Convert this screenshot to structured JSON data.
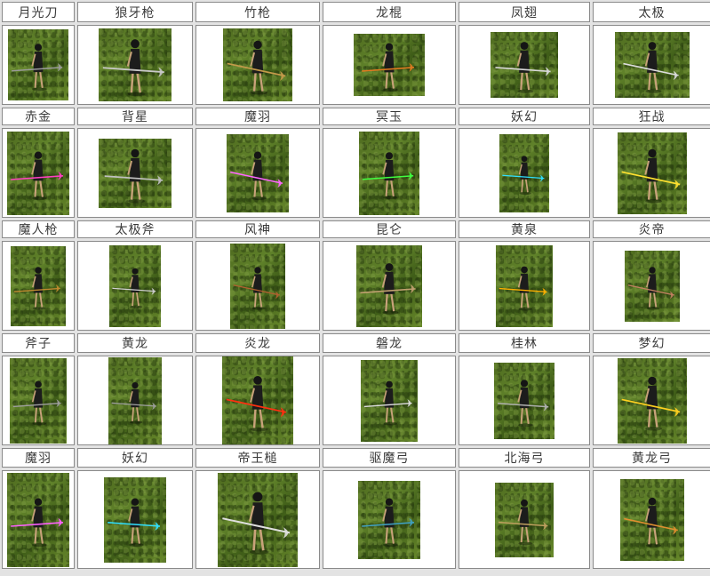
{
  "rows": [
    {
      "labels": [
        "月光刀",
        "狼牙枪",
        "竹枪",
        "龙棍",
        "凤翅",
        "太极"
      ],
      "colors": [
        "#9a9a9a",
        "#c8c8c8",
        "#c49a4a",
        "#e07a20",
        "#d8d8d8",
        "#dddddd"
      ]
    },
    {
      "labels": [
        "赤金",
        "背星",
        "魔羽",
        "冥玉",
        "妖幻",
        "狂战"
      ],
      "colors": [
        "#ff40c0",
        "#c0c0c0",
        "#ff66ff",
        "#40ff40",
        "#30e0ff",
        "#ffe030"
      ]
    },
    {
      "labels": [
        "魔人枪",
        "太极斧",
        "风神",
        "昆仑",
        "黄泉",
        "炎帝"
      ],
      "colors": [
        "#c08a30",
        "#d0d0d0",
        "#b06030",
        "#c0a070",
        "#ffb000",
        "#c08060"
      ]
    },
    {
      "labels": [
        "斧子",
        "黄龙",
        "炎龙",
        "磐龙",
        "桂林",
        "梦幻"
      ],
      "colors": [
        "#a0a0a0",
        "#a0a0a0",
        "#ff3010",
        "#e0e0e0",
        "#b0b0b0",
        "#ffd020"
      ]
    },
    {
      "labels": [
        "魔羽",
        "妖幻",
        "帝王槌",
        "驱魔弓",
        "北海弓",
        "黄龙弓"
      ],
      "colors": [
        "#ff60ff",
        "#30e0ff",
        "#e0e0e0",
        "#40a0c0",
        "#c0a060",
        "#e09030"
      ]
    }
  ],
  "thumb_sizes": [
    [
      [
        68,
        80
      ],
      [
        82,
        82
      ],
      [
        78,
        82
      ],
      [
        80,
        70
      ],
      [
        76,
        74
      ],
      [
        84,
        74
      ]
    ],
    [
      [
        70,
        94
      ],
      [
        82,
        78
      ],
      [
        70,
        88
      ],
      [
        68,
        94
      ],
      [
        56,
        88
      ],
      [
        78,
        92
      ]
    ],
    [
      [
        62,
        90
      ],
      [
        58,
        92
      ],
      [
        62,
        96
      ],
      [
        74,
        92
      ],
      [
        64,
        92
      ],
      [
        62,
        80
      ]
    ],
    [
      [
        64,
        96
      ],
      [
        60,
        98
      ],
      [
        80,
        100
      ],
      [
        64,
        92
      ],
      [
        68,
        86
      ],
      [
        78,
        96
      ]
    ],
    [
      [
        70,
        106
      ],
      [
        70,
        96
      ],
      [
        90,
        106
      ],
      [
        70,
        88
      ],
      [
        66,
        84
      ],
      [
        72,
        92
      ]
    ]
  ]
}
